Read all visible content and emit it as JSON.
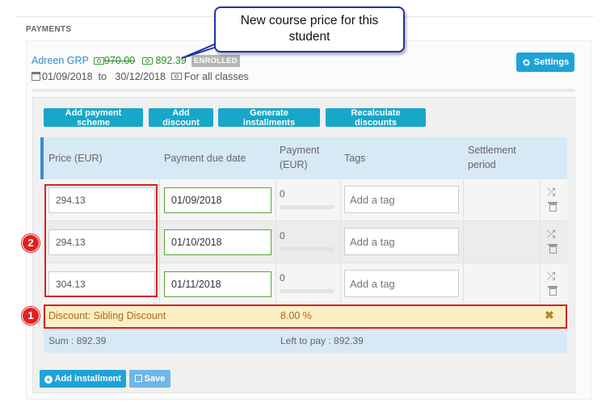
{
  "section_title": "PAYMENTS",
  "course": {
    "name": "Adreen GRP",
    "old_price": "970.00",
    "new_price": "892.39",
    "status_badge": "ENROLLED",
    "start_date": "01/09/2018",
    "date_separator": "to",
    "end_date": "30/12/2018",
    "classes_scope": "For all classes"
  },
  "settings_label": "Settings",
  "actions": {
    "add_payment_scheme": "Add payment scheme",
    "add_discount": "Add discount",
    "generate_installments": "Generate installments",
    "recalculate_discounts": "Recalculate discounts"
  },
  "table": {
    "headers": {
      "price": "Price (EUR)",
      "due_date": "Payment due date",
      "payment_line1": "Payment",
      "payment_line2": "(EUR)",
      "tags": "Tags",
      "settlement_line1": "Settlement",
      "settlement_line2": "period"
    },
    "tag_placeholder": "Add a tag",
    "rows": [
      {
        "price": "294.13",
        "due_date": "01/09/2018",
        "payment": "0"
      },
      {
        "price": "294.13",
        "due_date": "01/10/2018",
        "payment": "0"
      },
      {
        "price": "304.13",
        "due_date": "01/11/2018",
        "payment": "0"
      }
    ]
  },
  "discount": {
    "label": "Discount: Sibling Discount",
    "percent": "8.00 %"
  },
  "summary": {
    "sum": "Sum : 892.39",
    "left_to_pay": "Left to pay : 892.39"
  },
  "footer": {
    "add_installment": "Add installment",
    "save": "Save"
  },
  "annotations": {
    "callout_line1": "New course price for this",
    "callout_line2": "student",
    "marker_1": "1",
    "marker_2": "2"
  },
  "colors": {
    "accent": "#1ea3d9",
    "highlight_red": "#d62222",
    "price_green": "#2e8b2e",
    "discount_bg": "#fcefc4"
  }
}
